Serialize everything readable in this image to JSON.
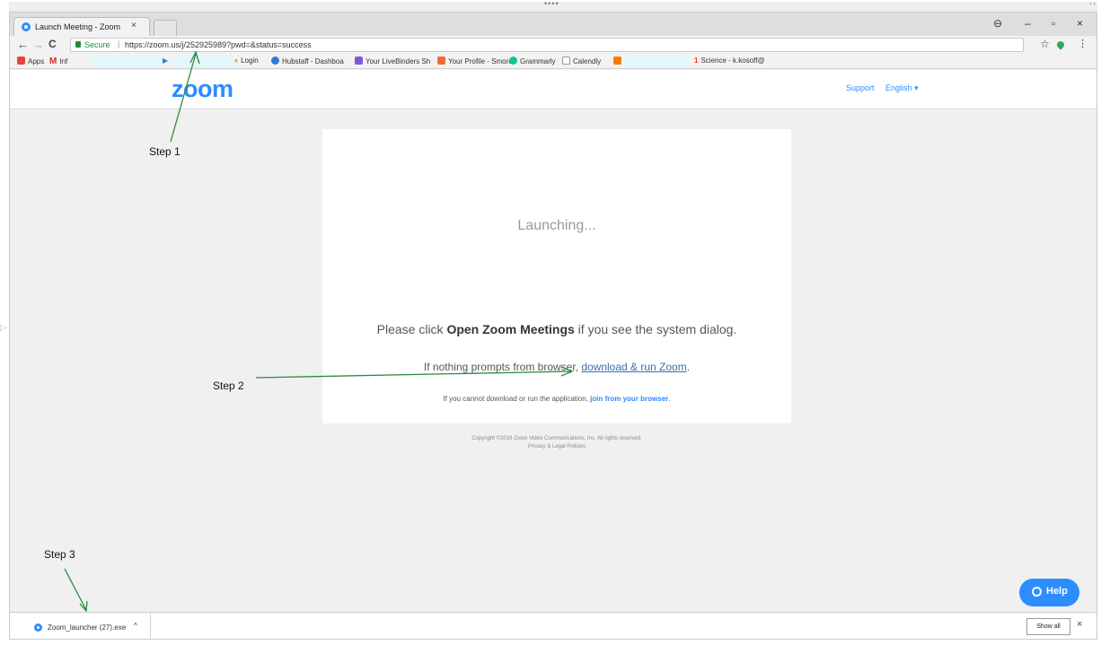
{
  "tab": {
    "title": "Launch Meeting - Zoom",
    "close": "×"
  },
  "window_controls": {
    "account": "⊖",
    "minimize": "–",
    "restore": "▫",
    "close": "×"
  },
  "nav": {
    "back": "←",
    "forward": "→",
    "reload": "C"
  },
  "address": {
    "secure_label": "Secure",
    "separator": "|",
    "url": "https://zoom.us/j/252925989?pwd=&status=success"
  },
  "bookmarks": [
    {
      "label": "Apps",
      "icon": "apps-grid-icon",
      "color": "#e84336"
    },
    {
      "label": "Inf",
      "icon": "gmail-icon",
      "color": "#d93025"
    },
    {
      "label": "Login",
      "icon": "flame-icon",
      "color": "#f4a300"
    },
    {
      "label": "Hubstaff - Dashboa",
      "icon": "hubstaff-icon",
      "color": "#2f7bd8"
    },
    {
      "label": "Your LiveBinders Sh",
      "icon": "livebinders-icon",
      "color": "#7b5bd1"
    },
    {
      "label": "Your Profile - Smore",
      "icon": "smore-icon",
      "color": "#f26b3a"
    },
    {
      "label": "Grammarly",
      "icon": "grammarly-icon",
      "color": "#15c39a"
    },
    {
      "label": "Calendly",
      "icon": "calendly-icon",
      "color": "#bbbbbb"
    },
    {
      "label": "Science - k.kosoff@",
      "icon": "science-icon",
      "color": "#e53935"
    }
  ],
  "header": {
    "logo": "zoom",
    "support": "Support",
    "language": "English ▾"
  },
  "card": {
    "launching": "Launching...",
    "please_pre": "Please click ",
    "please_bold": "Open Zoom Meetings",
    "please_post": " if you see the system dialog.",
    "nothing_pre": "If nothing prompts from browser, ",
    "nothing_link": "download & run Zoom",
    "nothing_post": ".",
    "cannot_pre": "If you cannot download or run the application, ",
    "cannot_link": "join from your browser",
    "cannot_post": "."
  },
  "footer": {
    "copyright": "Copyright ©2018 Zoom Video Communications, Inc. All rights reserved.",
    "privacy": "Privacy & Legal Policies"
  },
  "help": {
    "label": "Help"
  },
  "download": {
    "filename": "Zoom_launcher (27).exe",
    "caret": "^",
    "show_all": "Show all",
    "close": "×"
  },
  "annotations": {
    "step1": "Step 1",
    "step2": "Step 2",
    "step3": "Step 3"
  },
  "colors": {
    "zoom_blue": "#2d8cff",
    "annotation_green": "#2e8b3e",
    "secure_green": "#1e8e3e"
  }
}
